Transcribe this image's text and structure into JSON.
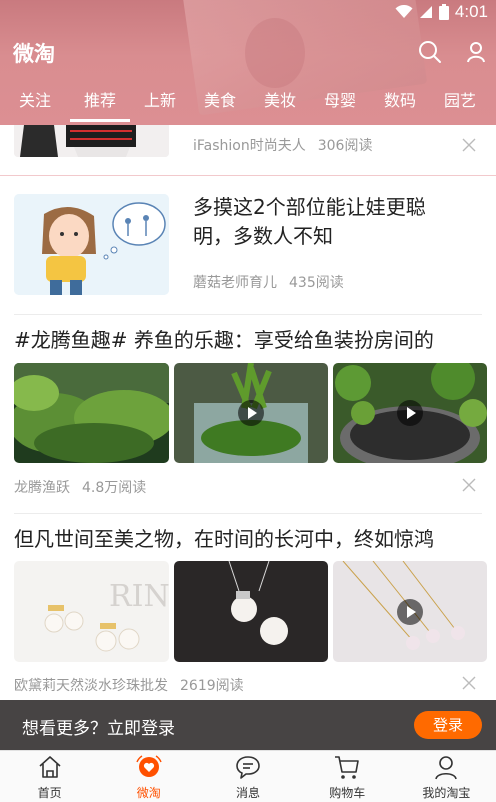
{
  "status": {
    "time": "4:01"
  },
  "header": {
    "title": "微淘",
    "tabs": [
      {
        "label": "关注"
      },
      {
        "label": "推荐",
        "active": true
      },
      {
        "label": "上新"
      },
      {
        "label": "美食"
      },
      {
        "label": "美妆"
      },
      {
        "label": "母婴"
      },
      {
        "label": "数码"
      },
      {
        "label": "园艺"
      }
    ]
  },
  "feed": {
    "top_card": {
      "author": "iFashion时尚夫人",
      "reads": "306阅读"
    },
    "card1": {
      "title_line1": "多摸这2个部位能让娃更聪",
      "title_line2": "明，多数人不知",
      "author": "蘑菇老师育儿",
      "reads": "435阅读"
    },
    "card2": {
      "title": "#龙腾鱼趣# 养鱼的乐趣：享受给鱼装扮房间的",
      "author": "龙腾渔跃",
      "reads": "4.8万阅读"
    },
    "card3": {
      "title": "但凡世间至美之物，在时间的长河中，终如惊鸿",
      "author": "欧黛莉天然淡水珍珠批发",
      "reads": "2619阅读"
    }
  },
  "login_banner": {
    "text": "想看更多？立即登录",
    "button": "登录"
  },
  "bottom_nav": [
    {
      "label": "首页",
      "icon": "home-icon"
    },
    {
      "label": "微淘",
      "icon": "weitao-heart-icon",
      "active": true
    },
    {
      "label": "消息",
      "icon": "message-icon"
    },
    {
      "label": "购物车",
      "icon": "cart-icon"
    },
    {
      "label": "我的淘宝",
      "icon": "profile-icon"
    }
  ],
  "colors": {
    "accent": "#ff5000",
    "login_button": "#ff6a00",
    "header": "#d98d90"
  }
}
